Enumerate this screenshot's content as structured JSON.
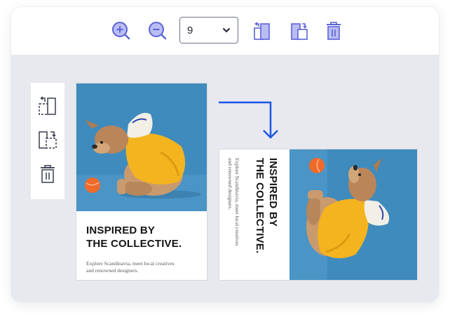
{
  "toolbar": {
    "zoom_in": "zoom-in-icon",
    "zoom_out": "zoom-out-icon",
    "page_select_value": "9",
    "rotate_left": "rotate-left-icon",
    "rotate_right": "rotate-right-icon",
    "delete": "trash-icon"
  },
  "side_panel": {
    "rotate_left": "rotate-left-icon",
    "rotate_right": "rotate-right-icon",
    "delete": "trash-icon"
  },
  "page": {
    "heading_line1": "INSPIRED BY",
    "heading_line2": "THE COLLECTIVE.",
    "subtext_line1": "Explore Scandinavia, meet local creatives",
    "subtext_line2": "and renowned designers."
  },
  "colors": {
    "accent": "#5b63d6",
    "accent_light": "#b9bdf2",
    "arrow": "#1f55e6",
    "backdrop": "#e7e9ee",
    "photo_bg": "#3f8bbd",
    "hoodie": "#f4b41f"
  }
}
